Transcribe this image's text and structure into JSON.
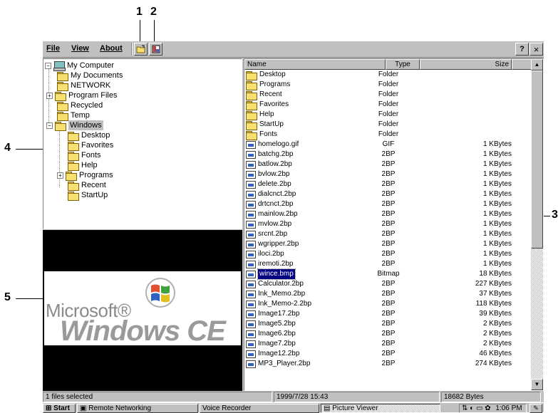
{
  "callouts": {
    "c1": "1",
    "c2": "2",
    "c3": "3",
    "c4": "4",
    "c5": "5"
  },
  "menu": {
    "file": "File",
    "view": "View",
    "about": "About",
    "help": "?",
    "close": "×"
  },
  "toolbar": {
    "open_icon": "open-folder-icon",
    "preview_icon": "preview-toggle-icon"
  },
  "tree": {
    "root": "My Computer",
    "items": [
      {
        "label": "My Documents"
      },
      {
        "label": "NETWORK"
      },
      {
        "label": "Program Files"
      },
      {
        "label": "Recycled"
      },
      {
        "label": "Temp"
      },
      {
        "label": "Windows"
      }
    ],
    "windows_children": [
      {
        "label": "Desktop"
      },
      {
        "label": "Favorites"
      },
      {
        "label": "Fonts"
      },
      {
        "label": "Help"
      },
      {
        "label": "Programs"
      },
      {
        "label": "Recent"
      },
      {
        "label": "StartUp"
      }
    ]
  },
  "preview": {
    "brand_top": "Microsoft®",
    "brand_bottom": "Windows CE"
  },
  "list": {
    "columns": [
      "Name",
      "Type",
      "Size"
    ],
    "rows": [
      {
        "name": "Desktop",
        "type": "Folder",
        "size": "",
        "kind": "folder"
      },
      {
        "name": "Programs",
        "type": "Folder",
        "size": "",
        "kind": "folder"
      },
      {
        "name": "Recent",
        "type": "Folder",
        "size": "",
        "kind": "folder"
      },
      {
        "name": "Favorites",
        "type": "Folder",
        "size": "",
        "kind": "folder"
      },
      {
        "name": "Help",
        "type": "Folder",
        "size": "",
        "kind": "folder"
      },
      {
        "name": "StartUp",
        "type": "Folder",
        "size": "",
        "kind": "folder"
      },
      {
        "name": "Fonts",
        "type": "Folder",
        "size": "",
        "kind": "folder"
      },
      {
        "name": "homelogo.gif",
        "type": "GIF",
        "size": "1  KBytes",
        "kind": "file"
      },
      {
        "name": "batchg.2bp",
        "type": "2BP",
        "size": "1  KBytes",
        "kind": "file"
      },
      {
        "name": "batlow.2bp",
        "type": "2BP",
        "size": "1  KBytes",
        "kind": "file"
      },
      {
        "name": "bvlow.2bp",
        "type": "2BP",
        "size": "1  KBytes",
        "kind": "file"
      },
      {
        "name": "delete.2bp",
        "type": "2BP",
        "size": "1  KBytes",
        "kind": "file"
      },
      {
        "name": "dialcnct.2bp",
        "type": "2BP",
        "size": "1  KBytes",
        "kind": "file"
      },
      {
        "name": "drtcnct.2bp",
        "type": "2BP",
        "size": "1  KBytes",
        "kind": "file"
      },
      {
        "name": "mainlow.2bp",
        "type": "2BP",
        "size": "1  KBytes",
        "kind": "file"
      },
      {
        "name": "mvlow.2bp",
        "type": "2BP",
        "size": "1  KBytes",
        "kind": "file"
      },
      {
        "name": "srcnt.2bp",
        "type": "2BP",
        "size": "1  KBytes",
        "kind": "file"
      },
      {
        "name": "wgripper.2bp",
        "type": "2BP",
        "size": "1  KBytes",
        "kind": "file"
      },
      {
        "name": "iloci.2bp",
        "type": "2BP",
        "size": "1  KBytes",
        "kind": "file"
      },
      {
        "name": "iremoti.2bp",
        "type": "2BP",
        "size": "1  KBytes",
        "kind": "file"
      },
      {
        "name": "wince.bmp",
        "type": "Bitmap",
        "size": "18  KBytes",
        "kind": "file",
        "selected": true
      },
      {
        "name": "Calculator.2bp",
        "type": "2BP",
        "size": "227  KBytes",
        "kind": "file"
      },
      {
        "name": "Ink_Memo.2bp",
        "type": "2BP",
        "size": "37  KBytes",
        "kind": "file"
      },
      {
        "name": "Ink_Memo-2.2bp",
        "type": "2BP",
        "size": "118  KBytes",
        "kind": "file"
      },
      {
        "name": "Image17.2bp",
        "type": "2BP",
        "size": "39  KBytes",
        "kind": "file"
      },
      {
        "name": "Image5.2bp",
        "type": "2BP",
        "size": "2  KBytes",
        "kind": "file"
      },
      {
        "name": "Image6.2bp",
        "type": "2BP",
        "size": "2  KBytes",
        "kind": "file"
      },
      {
        "name": "Image7.2bp",
        "type": "2BP",
        "size": "2  KBytes",
        "kind": "file"
      },
      {
        "name": "Image12.2bp",
        "type": "2BP",
        "size": "46  KBytes",
        "kind": "file"
      },
      {
        "name": "MP3_Player.2bp",
        "type": "2BP",
        "size": "274  KBytes",
        "kind": "file"
      }
    ]
  },
  "status": {
    "selection": "1 files selected",
    "datetime": "1999/7/28  15:43",
    "bytes": "18682 Bytes"
  },
  "taskbar": {
    "start": "Start",
    "tasks": [
      "Remote Networking",
      "Voice Recorder",
      "Picture Viewer"
    ],
    "clock": "1:06 PM"
  },
  "colors": {
    "selection": "#000080",
    "chrome": "#c0c0c0"
  }
}
